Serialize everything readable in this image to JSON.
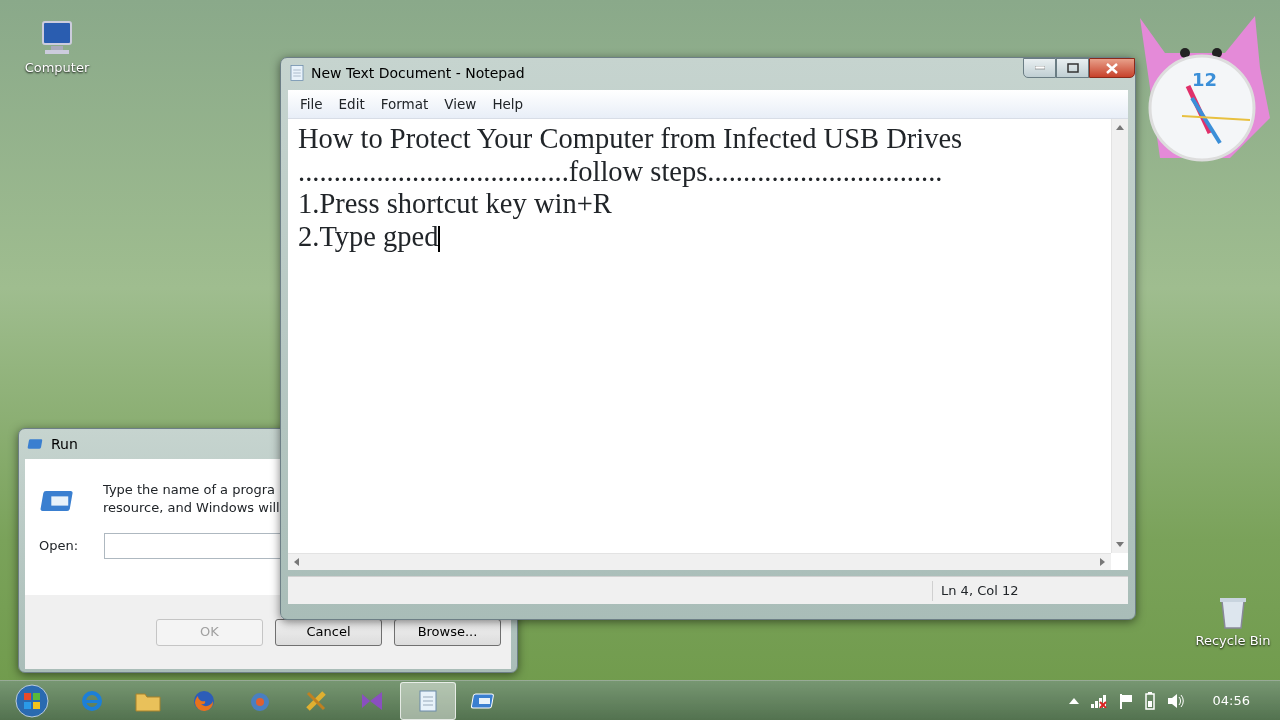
{
  "desktop_icons": [
    {
      "kind": "computer",
      "label": "Computer"
    },
    {
      "kind": "recycle",
      "label": "Recycle Bin"
    }
  ],
  "clock_gadget": {
    "numeral": "12"
  },
  "run_dialog": {
    "title": "Run",
    "message": [
      "Type the name of a progra",
      "resource, and Windows will"
    ],
    "open_label": "Open:",
    "buttons": [
      {
        "label": "OK",
        "disabled": true
      },
      {
        "label": "Cancel",
        "disabled": false
      },
      {
        "label": "Browse...",
        "disabled": false
      }
    ]
  },
  "notepad": {
    "title": "New Text Document - Notepad",
    "menu": [
      "File",
      "Edit",
      "Format",
      "View",
      "Help"
    ],
    "lines": [
      "How to Protect Your Computer from Infected USB Drives",
      "......................................follow steps.................................",
      "1.Press shortcut key win+R",
      "2.Type gped"
    ],
    "status": "Ln 4, Col 12"
  },
  "taskbar": {
    "items": [
      {
        "kind": "ie",
        "selected": false
      },
      {
        "kind": "folder",
        "selected": false
      },
      {
        "kind": "firefox",
        "selected": false
      },
      {
        "kind": "globe",
        "selected": false
      },
      {
        "kind": "tools",
        "selected": false
      },
      {
        "kind": "studio",
        "selected": false
      },
      {
        "kind": "notepad",
        "selected": true
      },
      {
        "kind": "run",
        "selected": false
      }
    ],
    "time": "04:56"
  }
}
